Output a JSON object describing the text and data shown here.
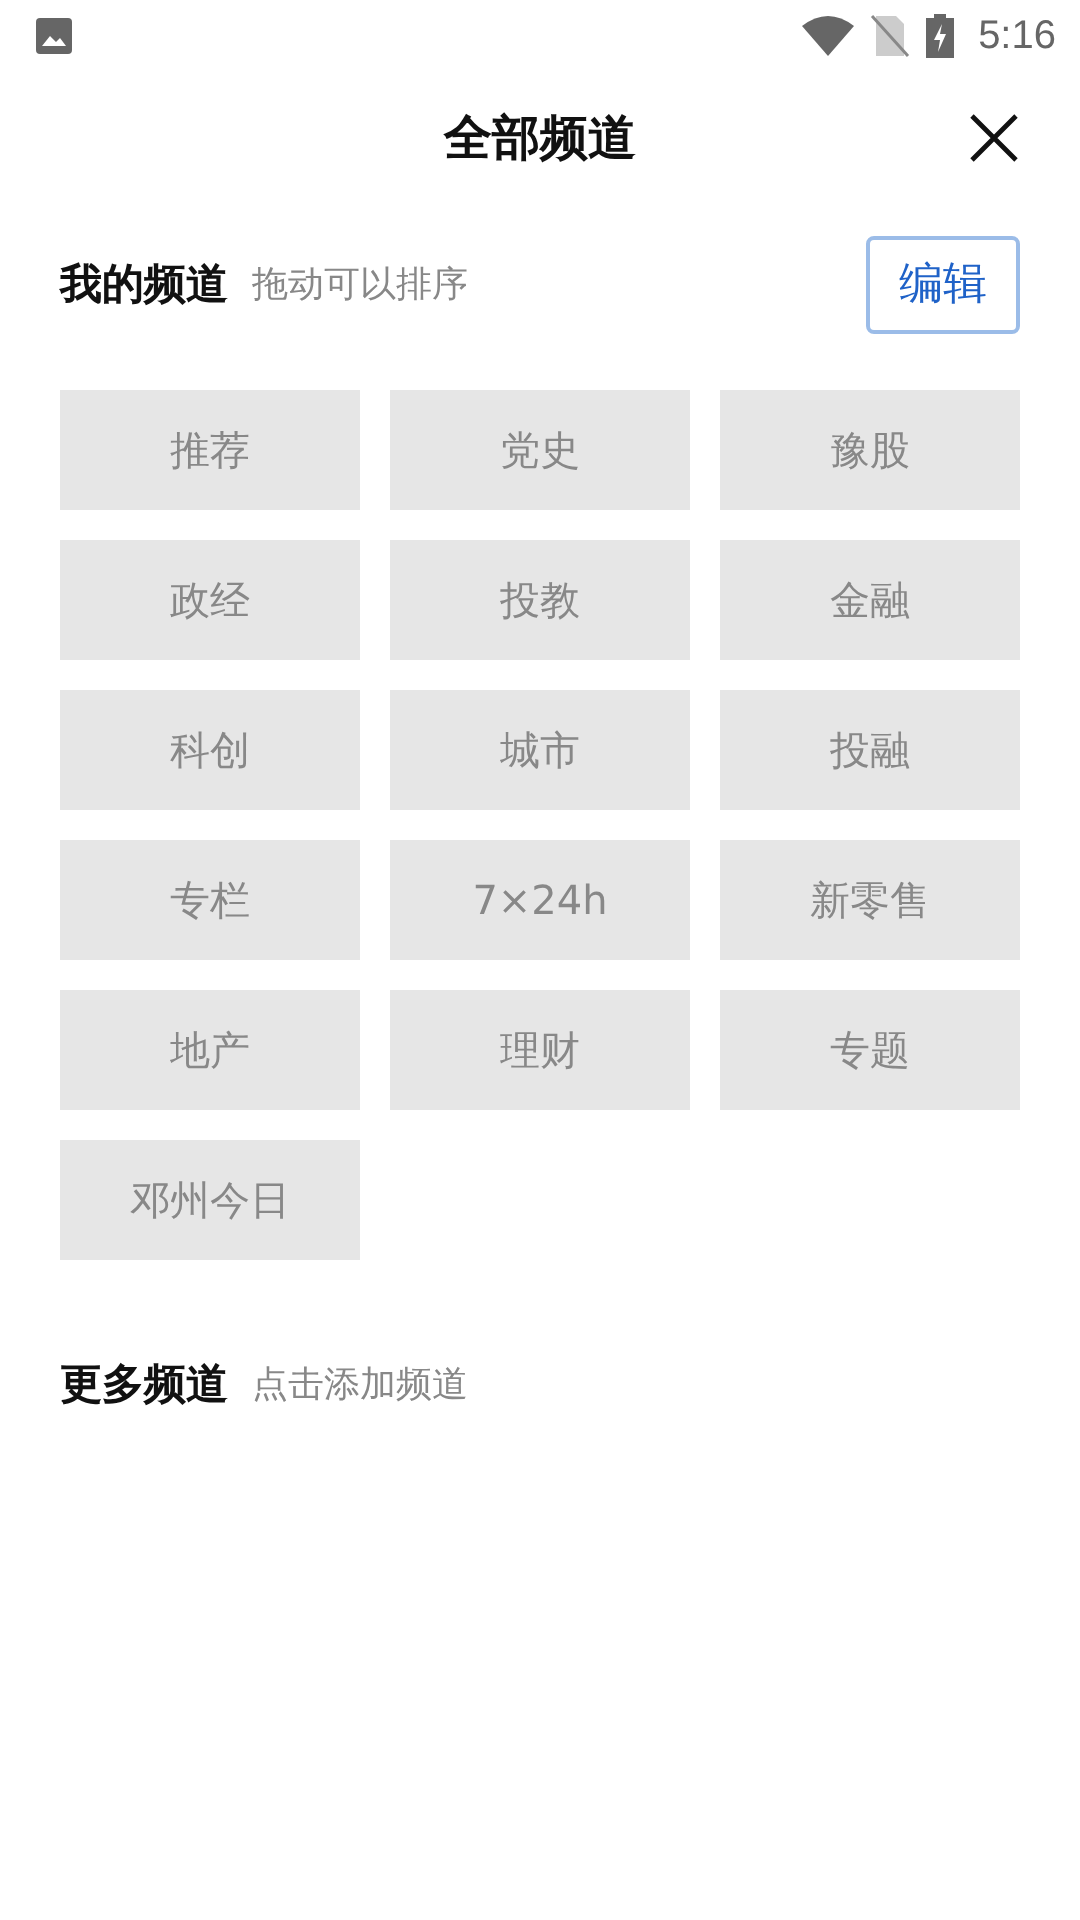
{
  "status_bar": {
    "time": "5:16"
  },
  "header": {
    "title": "全部频道"
  },
  "my_channels": {
    "title": "我的频道",
    "hint": "拖动可以排序",
    "edit_button": "编辑",
    "channels": [
      {
        "label": "推荐"
      },
      {
        "label": "党史"
      },
      {
        "label": "豫股"
      },
      {
        "label": "政经"
      },
      {
        "label": "投教"
      },
      {
        "label": "金融"
      },
      {
        "label": "科创"
      },
      {
        "label": "城市"
      },
      {
        "label": "投融"
      },
      {
        "label": "专栏"
      },
      {
        "label": "7×24h"
      },
      {
        "label": "新零售"
      },
      {
        "label": "地产"
      },
      {
        "label": "理财"
      },
      {
        "label": "专题"
      },
      {
        "label": "邓州今日"
      }
    ]
  },
  "more_channels": {
    "title": "更多频道",
    "hint": "点击添加频道"
  }
}
